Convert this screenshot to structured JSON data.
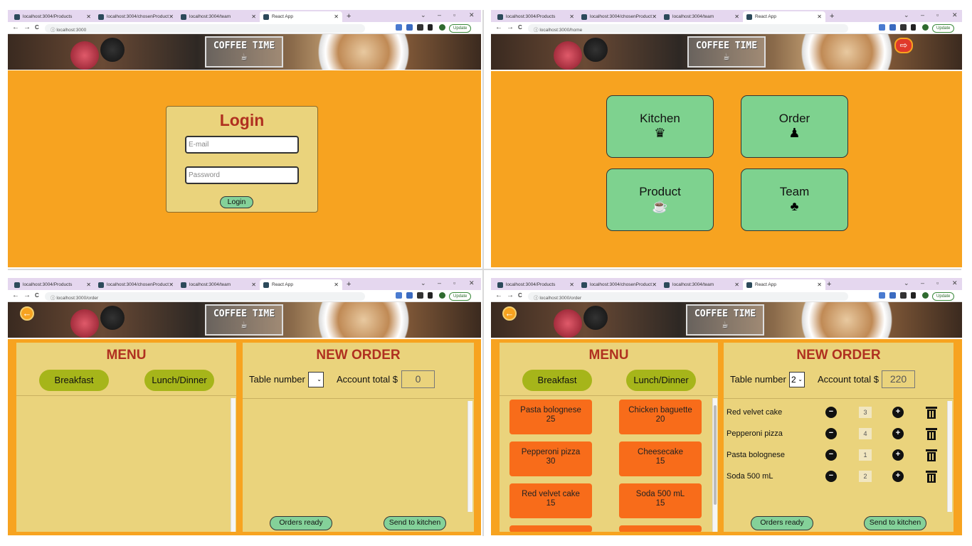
{
  "browser": {
    "tabs": [
      "localhost:3004/Products",
      "localhost:3004/chosenProduct",
      "localhost:3004/team",
      "React App"
    ],
    "new_tab": "+",
    "update_label": "Update",
    "win_min": "–",
    "win_max": "▫",
    "win_close": "✕",
    "back": "←",
    "forward": "→",
    "reload": "C"
  },
  "logo": {
    "title": "COFFEE TIME",
    "icon": "coffee-mug-icon"
  },
  "login_window": {
    "url": "localhost:3000",
    "heading": "Login",
    "email_placeholder": "E-mail",
    "password_placeholder": "Password",
    "submit_label": "Login"
  },
  "home_window": {
    "url": "localhost:3000/home",
    "logout_icon": "logout-icon",
    "cards": [
      {
        "label": "Kitchen",
        "icon": "chef-hat-icon",
        "glyph": "♛"
      },
      {
        "label": "Order",
        "icon": "waiter-icon",
        "glyph": "♟"
      },
      {
        "label": "Product",
        "icon": "coffee-cup-icon",
        "glyph": "☕"
      },
      {
        "label": "Team",
        "icon": "team-icon",
        "glyph": "♣"
      }
    ]
  },
  "order_empty": {
    "url": "localhost:3000/order",
    "menu_title": "MENU",
    "breakfast": "Breakfast",
    "lunch": "Lunch/Dinner",
    "new_order_title": "NEW ORDER",
    "table_label": "Table number",
    "table_value": "",
    "account_label": "Account total $",
    "account_total": "0",
    "orders_ready": "Orders ready",
    "send_kitchen": "Send to kitchen"
  },
  "order_filled": {
    "url": "localhost:3000/order",
    "menu_title": "MENU",
    "breakfast": "Breakfast",
    "lunch": "Lunch/Dinner",
    "new_order_title": "NEW ORDER",
    "table_label": "Table number",
    "table_value": "2",
    "account_label": "Account total $",
    "account_total": "220",
    "orders_ready": "Orders ready",
    "send_kitchen": "Send to kitchen",
    "menu_items": [
      {
        "name": "Pasta bolognese",
        "price": "25"
      },
      {
        "name": "Chicken baguette",
        "price": "20"
      },
      {
        "name": "Pepperoni pizza",
        "price": "30"
      },
      {
        "name": "Cheesecake",
        "price": "15"
      },
      {
        "name": "Red velvet cake",
        "price": "15"
      },
      {
        "name": "Soda 500 mL",
        "price": "15"
      }
    ],
    "order_items": [
      {
        "name": "Red velvet cake",
        "qty": "3"
      },
      {
        "name": "Pepperoni pizza",
        "qty": "4"
      },
      {
        "name": "Pasta bolognese",
        "qty": "1"
      },
      {
        "name": "Soda 500 mL",
        "qty": "2"
      }
    ]
  },
  "colors": {
    "orange": "#f7a320",
    "panel": "#ead37c",
    "title_red": "#b03020",
    "green": "#84d199",
    "olive": "#a6b51a",
    "item_orange": "#f86c1a"
  }
}
